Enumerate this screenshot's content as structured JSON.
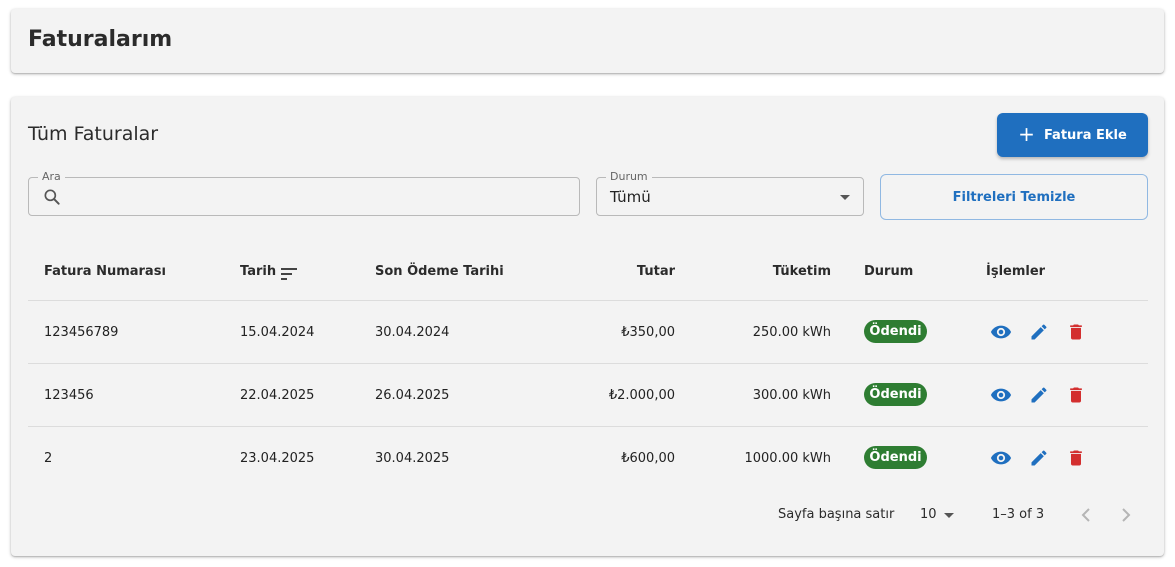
{
  "header": {
    "title": "Faturalarım"
  },
  "section": {
    "title": "Tüm Faturalar",
    "add_button_label": "Fatura Ekle",
    "add_icon": "plus-icon"
  },
  "filters": {
    "search_label": "Ara",
    "search_value": "",
    "search_icon": "search-icon",
    "status_label": "Durum",
    "status_value": "Tümü",
    "clear_button_label": "Filtreleri Temizle"
  },
  "table": {
    "columns": {
      "invoice_number": "Fatura Numarası",
      "date": "Tarih",
      "due_date": "Son Ödeme Tarihi",
      "amount": "Tutar",
      "consumption": "Tüketim",
      "status": "Durum",
      "actions": "İşlemler"
    },
    "sort_icon": "sort-icon",
    "rows": [
      {
        "invoice_number": "123456789",
        "date": "15.04.2024",
        "due_date": "30.04.2024",
        "amount": "₺350,00",
        "consumption": "250.00 kWh",
        "status": "Ödendi"
      },
      {
        "invoice_number": "123456",
        "date": "22.04.2025",
        "due_date": "26.04.2025",
        "amount": "₺2.000,00",
        "consumption": "300.00 kWh",
        "status": "Ödendi"
      },
      {
        "invoice_number": "2",
        "date": "23.04.2025",
        "due_date": "30.04.2025",
        "amount": "₺600,00",
        "consumption": "1000.00 kWh",
        "status": "Ödendi"
      }
    ],
    "action_icons": [
      "eye-icon",
      "pencil-icon",
      "trash-icon"
    ]
  },
  "pagination": {
    "rows_per_page_label": "Sayfa başına satır",
    "rows_per_page_value": "10",
    "range_text": "1–3 of 3"
  },
  "colors": {
    "primary": "#1f6fbf",
    "success": "#2e7d32",
    "danger": "#d32f2f",
    "card_bg": "#f3f3f3"
  }
}
